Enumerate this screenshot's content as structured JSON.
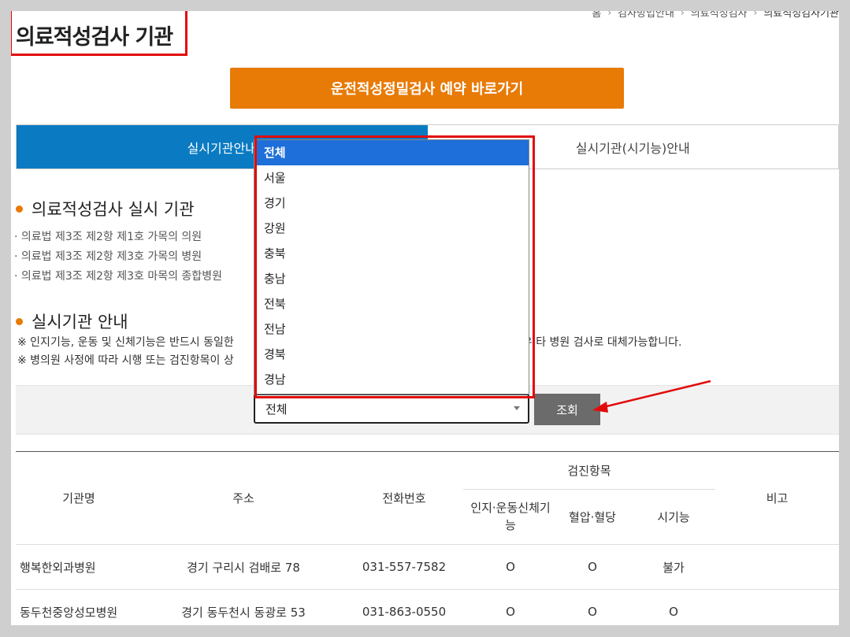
{
  "breadcrumb": [
    "홈",
    "검사방법안내",
    "의료적성검사",
    "의료적성검사기관"
  ],
  "page_title": "의료적성검사 기관",
  "reserve_button": "운전적성정밀검사 예약 바로가기",
  "tabs": [
    "실시기관안내",
    "실시기관(시기능)안내"
  ],
  "section1": {
    "heading": "의료적성검사 실시 기관",
    "items": [
      "· 의료법 제3조 제2항 제1호 가목의 의원",
      "· 의료법 제3조 제2항 제3호 가목의 병원",
      "· 의료법 제3조 제2항 제3호 마목의 종합병원"
    ]
  },
  "section2": {
    "heading": "실시기관 안내",
    "note1_left": "※ 인지기능, 운동 및 신체기능은 반드시 동일한",
    "note1_right": "경우 타 병원 검사로 대체가능합니다.",
    "note2_left": "※ 병의원 사정에 따라 시행 또는 검진항목이 상"
  },
  "search": {
    "selected": "전체",
    "button": "조회",
    "options": [
      "전체",
      "서울",
      "경기",
      "강원",
      "충북",
      "충남",
      "전북",
      "전남",
      "경북",
      "경남"
    ]
  },
  "table": {
    "headers": {
      "name": "기관명",
      "address": "주소",
      "phone": "전화번호",
      "group": "검진항목",
      "cognitive": "인지·운동신체기능",
      "blood": "혈압·혈당",
      "vision": "시기능",
      "note": "비고"
    },
    "rows": [
      {
        "name": "행복한외과병원",
        "address": "경기 구리시 검배로 78",
        "phone": "031-557-7582",
        "cognitive": "O",
        "blood": "O",
        "vision": "불가",
        "note": ""
      },
      {
        "name": "동두천중앙성모병원",
        "address": "경기 동두천시 동광로 53",
        "phone": "031-863-0550",
        "cognitive": "O",
        "blood": "O",
        "vision": "O",
        "note": ""
      }
    ]
  },
  "colors": {
    "accent_orange": "#e87a06",
    "tab_active": "#0a7bc3",
    "highlight_red": "#e20b0b",
    "option_selected": "#1e6fd9"
  }
}
